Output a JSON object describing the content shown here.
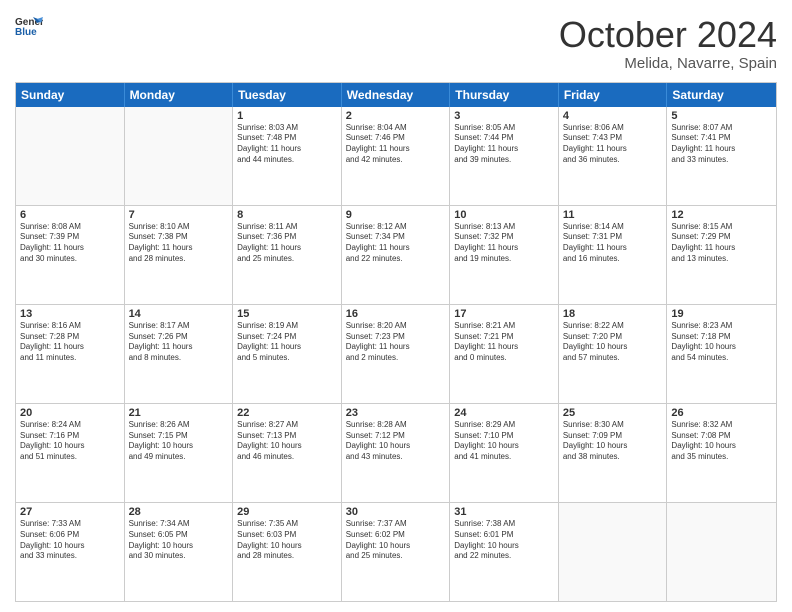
{
  "logo": {
    "line1": "General",
    "line2": "Blue"
  },
  "title": "October 2024",
  "location": "Melida, Navarre, Spain",
  "header_days": [
    "Sunday",
    "Monday",
    "Tuesday",
    "Wednesday",
    "Thursday",
    "Friday",
    "Saturday"
  ],
  "rows": [
    [
      {
        "day": "",
        "lines": []
      },
      {
        "day": "",
        "lines": []
      },
      {
        "day": "1",
        "lines": [
          "Sunrise: 8:03 AM",
          "Sunset: 7:48 PM",
          "Daylight: 11 hours",
          "and 44 minutes."
        ]
      },
      {
        "day": "2",
        "lines": [
          "Sunrise: 8:04 AM",
          "Sunset: 7:46 PM",
          "Daylight: 11 hours",
          "and 42 minutes."
        ]
      },
      {
        "day": "3",
        "lines": [
          "Sunrise: 8:05 AM",
          "Sunset: 7:44 PM",
          "Daylight: 11 hours",
          "and 39 minutes."
        ]
      },
      {
        "day": "4",
        "lines": [
          "Sunrise: 8:06 AM",
          "Sunset: 7:43 PM",
          "Daylight: 11 hours",
          "and 36 minutes."
        ]
      },
      {
        "day": "5",
        "lines": [
          "Sunrise: 8:07 AM",
          "Sunset: 7:41 PM",
          "Daylight: 11 hours",
          "and 33 minutes."
        ]
      }
    ],
    [
      {
        "day": "6",
        "lines": [
          "Sunrise: 8:08 AM",
          "Sunset: 7:39 PM",
          "Daylight: 11 hours",
          "and 30 minutes."
        ]
      },
      {
        "day": "7",
        "lines": [
          "Sunrise: 8:10 AM",
          "Sunset: 7:38 PM",
          "Daylight: 11 hours",
          "and 28 minutes."
        ]
      },
      {
        "day": "8",
        "lines": [
          "Sunrise: 8:11 AM",
          "Sunset: 7:36 PM",
          "Daylight: 11 hours",
          "and 25 minutes."
        ]
      },
      {
        "day": "9",
        "lines": [
          "Sunrise: 8:12 AM",
          "Sunset: 7:34 PM",
          "Daylight: 11 hours",
          "and 22 minutes."
        ]
      },
      {
        "day": "10",
        "lines": [
          "Sunrise: 8:13 AM",
          "Sunset: 7:32 PM",
          "Daylight: 11 hours",
          "and 19 minutes."
        ]
      },
      {
        "day": "11",
        "lines": [
          "Sunrise: 8:14 AM",
          "Sunset: 7:31 PM",
          "Daylight: 11 hours",
          "and 16 minutes."
        ]
      },
      {
        "day": "12",
        "lines": [
          "Sunrise: 8:15 AM",
          "Sunset: 7:29 PM",
          "Daylight: 11 hours",
          "and 13 minutes."
        ]
      }
    ],
    [
      {
        "day": "13",
        "lines": [
          "Sunrise: 8:16 AM",
          "Sunset: 7:28 PM",
          "Daylight: 11 hours",
          "and 11 minutes."
        ]
      },
      {
        "day": "14",
        "lines": [
          "Sunrise: 8:17 AM",
          "Sunset: 7:26 PM",
          "Daylight: 11 hours",
          "and 8 minutes."
        ]
      },
      {
        "day": "15",
        "lines": [
          "Sunrise: 8:19 AM",
          "Sunset: 7:24 PM",
          "Daylight: 11 hours",
          "and 5 minutes."
        ]
      },
      {
        "day": "16",
        "lines": [
          "Sunrise: 8:20 AM",
          "Sunset: 7:23 PM",
          "Daylight: 11 hours",
          "and 2 minutes."
        ]
      },
      {
        "day": "17",
        "lines": [
          "Sunrise: 8:21 AM",
          "Sunset: 7:21 PM",
          "Daylight: 11 hours",
          "and 0 minutes."
        ]
      },
      {
        "day": "18",
        "lines": [
          "Sunrise: 8:22 AM",
          "Sunset: 7:20 PM",
          "Daylight: 10 hours",
          "and 57 minutes."
        ]
      },
      {
        "day": "19",
        "lines": [
          "Sunrise: 8:23 AM",
          "Sunset: 7:18 PM",
          "Daylight: 10 hours",
          "and 54 minutes."
        ]
      }
    ],
    [
      {
        "day": "20",
        "lines": [
          "Sunrise: 8:24 AM",
          "Sunset: 7:16 PM",
          "Daylight: 10 hours",
          "and 51 minutes."
        ]
      },
      {
        "day": "21",
        "lines": [
          "Sunrise: 8:26 AM",
          "Sunset: 7:15 PM",
          "Daylight: 10 hours",
          "and 49 minutes."
        ]
      },
      {
        "day": "22",
        "lines": [
          "Sunrise: 8:27 AM",
          "Sunset: 7:13 PM",
          "Daylight: 10 hours",
          "and 46 minutes."
        ]
      },
      {
        "day": "23",
        "lines": [
          "Sunrise: 8:28 AM",
          "Sunset: 7:12 PM",
          "Daylight: 10 hours",
          "and 43 minutes."
        ]
      },
      {
        "day": "24",
        "lines": [
          "Sunrise: 8:29 AM",
          "Sunset: 7:10 PM",
          "Daylight: 10 hours",
          "and 41 minutes."
        ]
      },
      {
        "day": "25",
        "lines": [
          "Sunrise: 8:30 AM",
          "Sunset: 7:09 PM",
          "Daylight: 10 hours",
          "and 38 minutes."
        ]
      },
      {
        "day": "26",
        "lines": [
          "Sunrise: 8:32 AM",
          "Sunset: 7:08 PM",
          "Daylight: 10 hours",
          "and 35 minutes."
        ]
      }
    ],
    [
      {
        "day": "27",
        "lines": [
          "Sunrise: 7:33 AM",
          "Sunset: 6:06 PM",
          "Daylight: 10 hours",
          "and 33 minutes."
        ]
      },
      {
        "day": "28",
        "lines": [
          "Sunrise: 7:34 AM",
          "Sunset: 6:05 PM",
          "Daylight: 10 hours",
          "and 30 minutes."
        ]
      },
      {
        "day": "29",
        "lines": [
          "Sunrise: 7:35 AM",
          "Sunset: 6:03 PM",
          "Daylight: 10 hours",
          "and 28 minutes."
        ]
      },
      {
        "day": "30",
        "lines": [
          "Sunrise: 7:37 AM",
          "Sunset: 6:02 PM",
          "Daylight: 10 hours",
          "and 25 minutes."
        ]
      },
      {
        "day": "31",
        "lines": [
          "Sunrise: 7:38 AM",
          "Sunset: 6:01 PM",
          "Daylight: 10 hours",
          "and 22 minutes."
        ]
      },
      {
        "day": "",
        "lines": []
      },
      {
        "day": "",
        "lines": []
      }
    ]
  ]
}
